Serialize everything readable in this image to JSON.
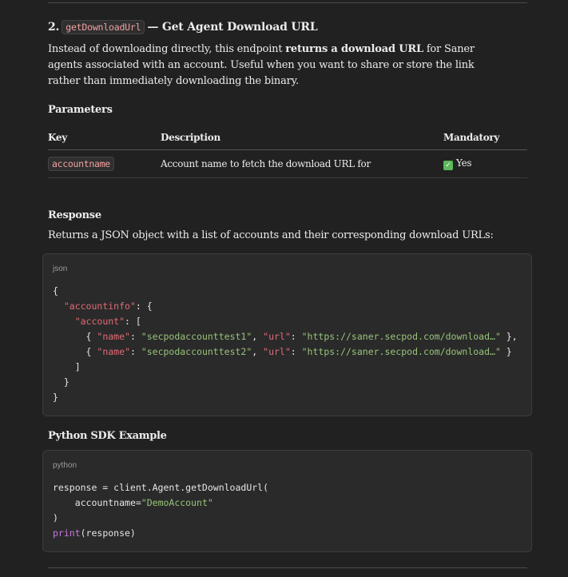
{
  "section": {
    "number": "2.",
    "method": "getDownloadUrl",
    "title_suffix": "— Get Agent Download URL",
    "intro_pre": "Instead of downloading directly, this endpoint ",
    "intro_bold": "returns a download URL",
    "intro_post": " for Saner agents associated with an account. Useful when you want to share or store the link rather than immediately downloading the binary."
  },
  "parameters": {
    "heading": "Parameters",
    "columns": [
      "Key",
      "Description",
      "Mandatory"
    ],
    "rows": [
      {
        "key": "accountname",
        "description": "Account name to fetch the download URL for",
        "mandatory": "Yes"
      }
    ]
  },
  "response": {
    "heading": "Response",
    "text": "Returns a JSON object with a list of accounts and their corresponding download URLs:",
    "lang": "json",
    "lines": {
      "l1": "{",
      "l2_key": "\"accountinfo\"",
      "l2_rest": ": {",
      "l3_key": "\"account\"",
      "l3_rest": ": [",
      "l4_k1": "\"name\"",
      "l4_v1": "\"secpodaccounttest1\"",
      "l4_k2": "\"url\"",
      "l4_v2": "\"https://saner.secpod.com/download…\"",
      "l5_k1": "\"name\"",
      "l5_v1": "\"secpodaccounttest2\"",
      "l5_k2": "\"url\"",
      "l5_v2": "\"https://saner.secpod.com/download…\"",
      "l6": "]",
      "l7": "}",
      "l8": "}"
    }
  },
  "sdk": {
    "heading": "Python SDK Example",
    "lang": "python",
    "line1": "response = client.Agent.getDownloadUrl(",
    "line2_arg": "accountname=",
    "line2_val": "\"DemoAccount\"",
    "line3": ")",
    "line4_fn": "print",
    "line4_rest": "(response)"
  }
}
